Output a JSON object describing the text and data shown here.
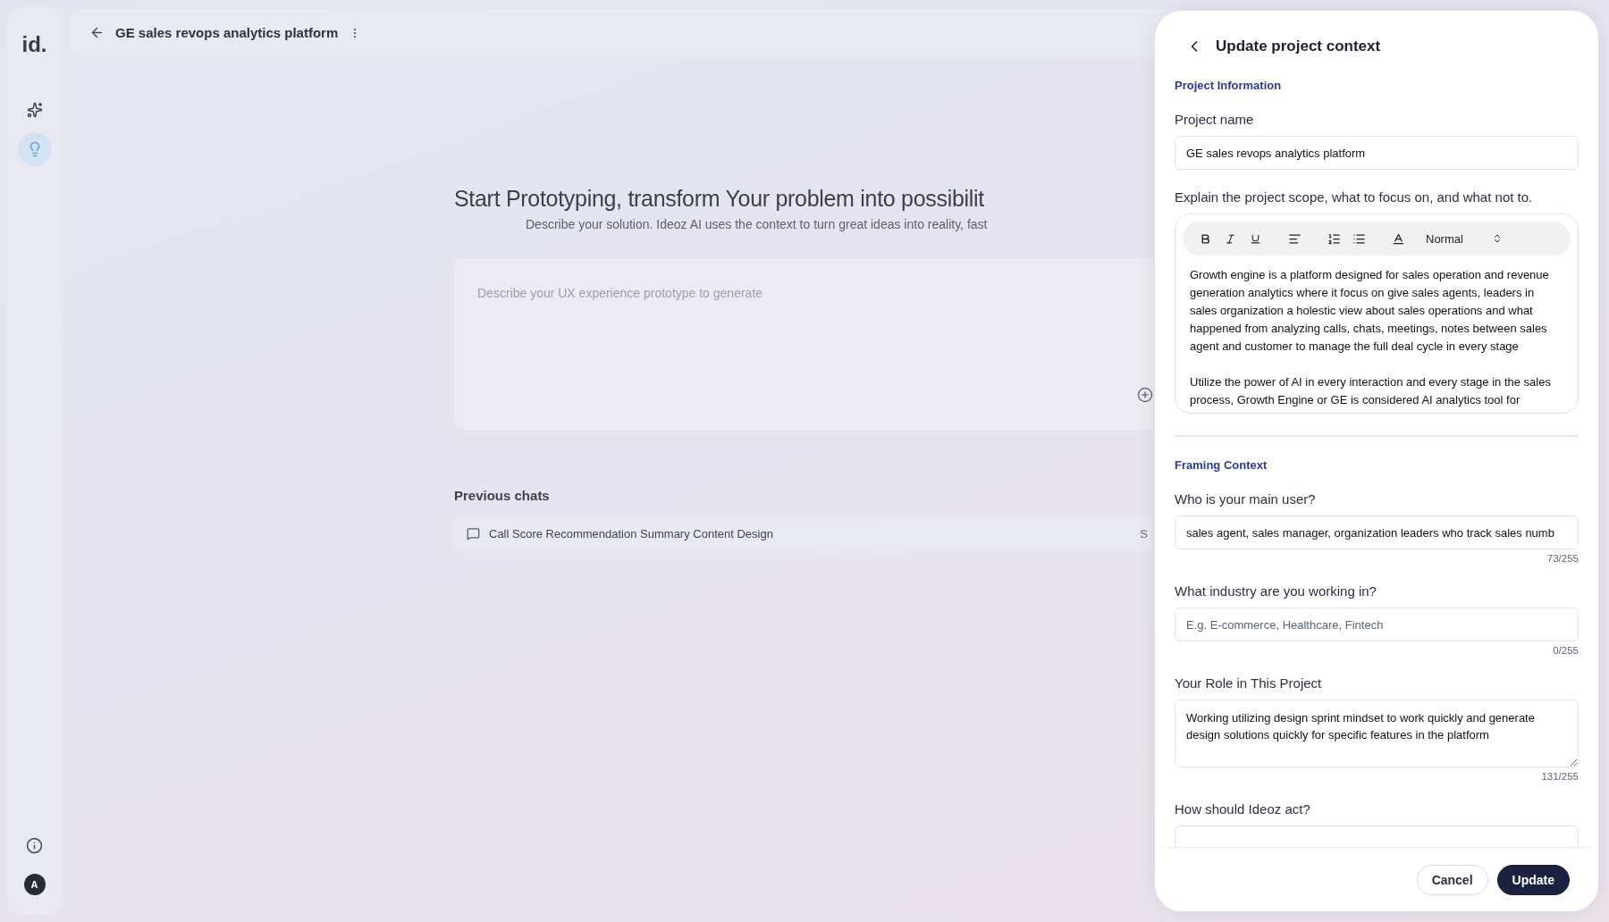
{
  "sidebar": {
    "logo": "id.",
    "items": [
      {
        "selected": false
      },
      {
        "selected": true
      }
    ],
    "bottom": {
      "avatar": "A"
    }
  },
  "header": {
    "title": "GE sales revops analytics platform"
  },
  "main": {
    "heading": "Start Prototyping, transform Your problem into possibilit",
    "subheading": "Describe your solution. Ideoz AI uses the context to turn great ideas into reality, fast",
    "prompt": {
      "placeholder": "Describe your UX experience prototype to generate"
    },
    "previous_chats": {
      "title": "Previous chats",
      "items": [
        {
          "title": "Call Score Recommendation Summary Content Design",
          "column_2": "S"
        }
      ]
    }
  },
  "panel": {
    "title": "Update project context",
    "sections": [
      {
        "title": "Project Information",
        "fields": [
          {
            "kind": "input",
            "label": "Project name",
            "value": "GE sales revops analytics platform"
          },
          {
            "kind": "editor",
            "label": "Explain the project scope, what to focus on, and what not to.",
            "toolbar": {
              "style": "Normal"
            },
            "paragraphs": [
              "Growth engine is a platform designed for sales operation and revenue generation analytics where it focus on give sales agents, leaders in sales organization a holestic view about sales operations and what happened from analyzing calls, chats, meetings, notes between sales agent and customer to manage the full deal cycle in every stage",
              "Utilize the power of AI in every interaction and every stage in the sales process, Growth Engine or GE is considered AI analytics tool for"
            ]
          }
        ]
      },
      {
        "title": "Framing Context",
        "fields": [
          {
            "kind": "input",
            "label": "Who is your main user?",
            "value": "sales agent, sales manager, organization leaders who track sales numb",
            "counter": "73/255"
          },
          {
            "kind": "input",
            "label": "What industry are you working in?",
            "placeholder": "E.g. E-commerce, Healthcare, Fintech",
            "counter": "0/255"
          },
          {
            "kind": "textarea",
            "label": "Your Role in This Project",
            "value": "Working utilizing design sprint mindset to work quickly and generate design solutions quickly for specific features in the platform",
            "counter": "131/255"
          },
          {
            "kind": "input",
            "label": "How should Ideoz act?"
          }
        ]
      }
    ],
    "buttons": [
      {
        "label": "Cancel",
        "kind": "secondary"
      },
      {
        "label": "Update",
        "kind": "primary"
      }
    ]
  }
}
